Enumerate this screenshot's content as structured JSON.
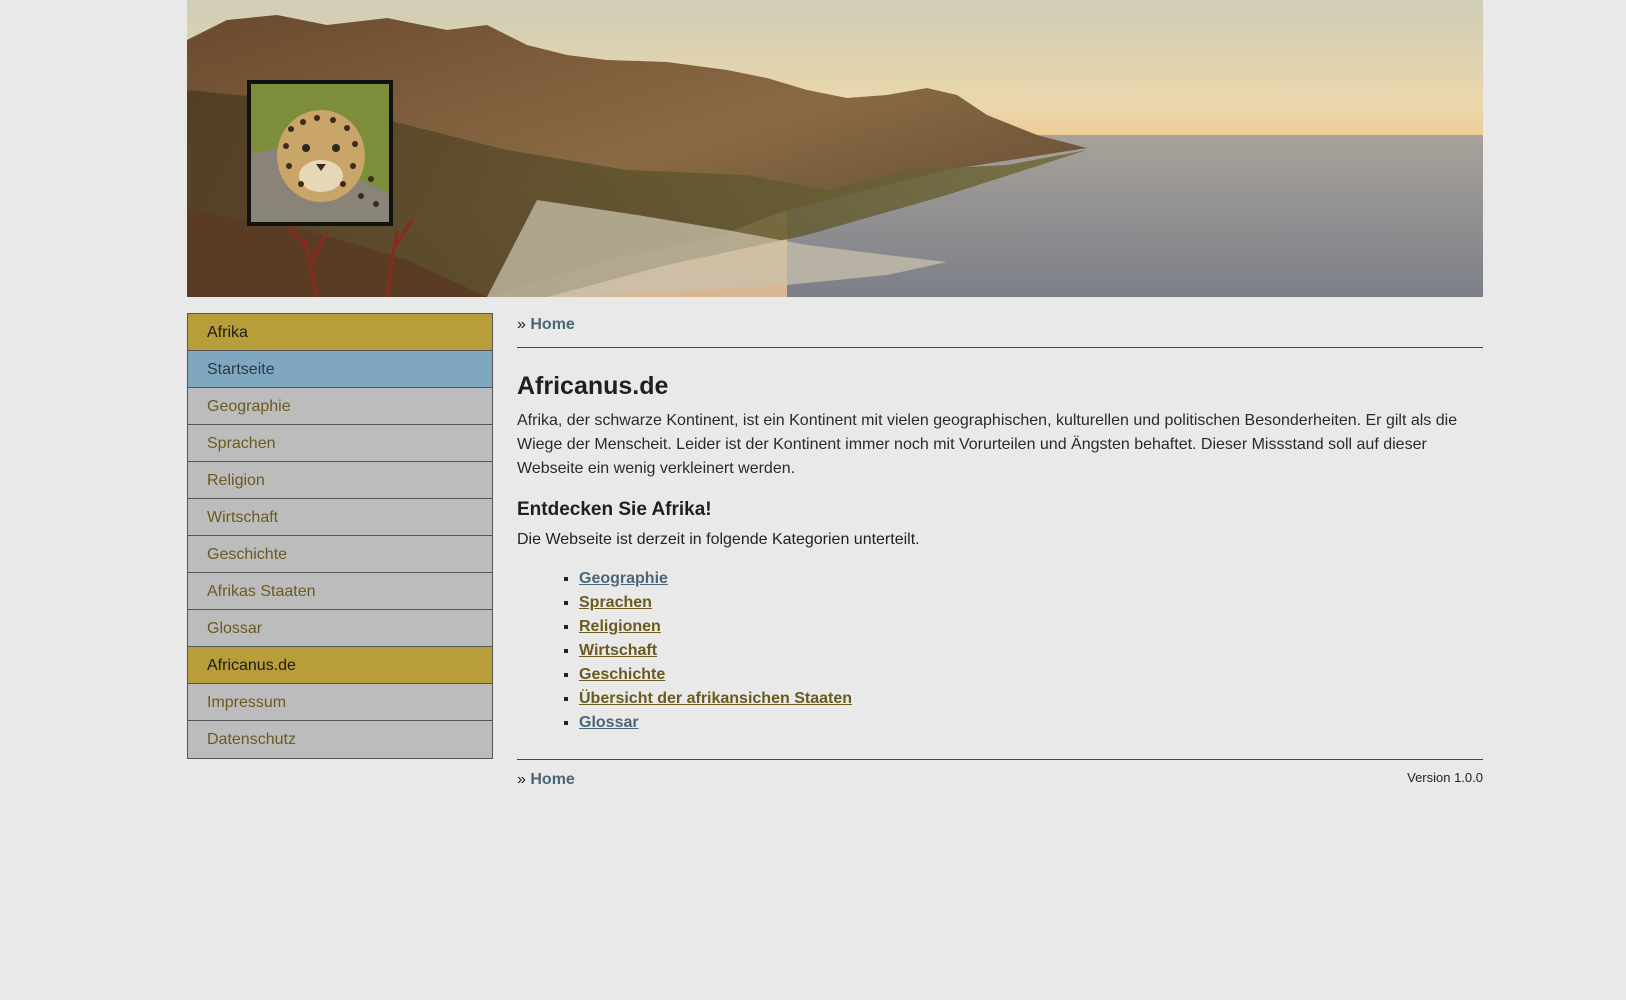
{
  "banner": {
    "alt": "Landscape with mountains and coast"
  },
  "sidebar": {
    "items": [
      {
        "label": "Afrika"
      },
      {
        "label": "Startseite"
      },
      {
        "label": "Geographie"
      },
      {
        "label": "Sprachen"
      },
      {
        "label": "Religion"
      },
      {
        "label": "Wirtschaft"
      },
      {
        "label": "Geschichte"
      },
      {
        "label": "Afrikas Staaten"
      },
      {
        "label": "Glossar"
      },
      {
        "label": "Africanus.de"
      },
      {
        "label": "Impressum"
      },
      {
        "label": "Datenschutz"
      }
    ]
  },
  "breadcrumb": {
    "prefix": "»",
    "home": "Home"
  },
  "main": {
    "title": "Africanus.de",
    "intro": "Afrika, der schwarze Kontinent, ist ein Kontinent mit vielen geographischen, kulturellen und politischen Besonderheiten. Er gilt als die Wiege der Menscheit. Leider ist der Kontinent immer noch mit Vorurteilen und Ängsten behaftet. Dieser Missstand soll auf dieser Webseite ein wenig verkleinert werden.",
    "subtitle": "Entdecken Sie Afrika!",
    "subtext": "Die Webseite ist derzeit in folgende Kategorien unterteilt.",
    "categories": [
      {
        "label": "Geographie"
      },
      {
        "label": "Sprachen"
      },
      {
        "label": "Religionen"
      },
      {
        "label": "Wirtschaft"
      },
      {
        "label": "Geschichte"
      },
      {
        "label": "Übersicht der afrikansichen Staaten"
      },
      {
        "label": "Glossar"
      }
    ]
  },
  "footer": {
    "prefix": "»",
    "home": "Home",
    "version": "Version 1.0.0"
  },
  "colors": {
    "background": "#e9e9e9",
    "nav_gold": "#b89d3b",
    "nav_active": "#7fa7bf",
    "nav_default": "#bcbcbc",
    "link_blue": "#4b6675",
    "link_gold": "#6b5a1e"
  }
}
